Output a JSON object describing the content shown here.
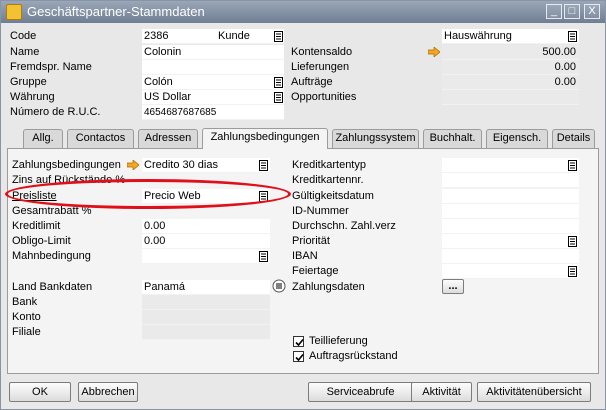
{
  "window": {
    "title": "Geschäftspartner-Stammdaten",
    "minimize": "_",
    "restore": "□",
    "close": "X"
  },
  "header": {
    "code_label": "Code",
    "code_value": "2386",
    "type_value": "Kunde",
    "name_label": "Name",
    "name_value": "Colonin",
    "foreign_label": "Fremdspr. Name",
    "foreign_value": "",
    "group_label": "Gruppe",
    "group_value": "Colón",
    "currency_label": "Währung",
    "currency_value": "US Dollar",
    "ruc_label": "Número de R.U.C.",
    "ruc_value": "4654687687685",
    "currency_mode_value": "Hauswährung",
    "balance_label": "Kontensaldo",
    "balance_value": "500.00",
    "deliveries_label": "Lieferungen",
    "deliveries_value": "0.00",
    "orders_label": "Aufträge",
    "orders_value": "0.00",
    "opportunities_label": "Opportunities",
    "opportunities_value": ""
  },
  "tabs": [
    "Allg.",
    "Contactos",
    "Adressen",
    "Zahlungsbedingungen",
    "Zahlungssystem",
    "Buchhalt.",
    "Eigensch.",
    "Details"
  ],
  "payment": {
    "terms_label": "Zahlungsbedingungen",
    "terms_value": "Credito 30 dias",
    "interest_label": "Zins auf Rückstände %",
    "pricelist_label": "Preisliste",
    "pricelist_value": "Precio Web",
    "discount_label": "Gesamtrabatt %",
    "creditlimit_label": "Kreditlimit",
    "creditlimit_value": "0.00",
    "commitment_label": "Obligo-Limit",
    "commitment_value": "0.00",
    "dunning_label": "Mahnbedingung",
    "dunning_value": "",
    "bankcountry_label": "Land Bankdaten",
    "bankcountry_value": "Panamá",
    "bank_label": "Bank",
    "account_label": "Konto",
    "branch_label": "Filiale",
    "cardtype_label": "Kreditkartentyp",
    "cardno_label": "Kreditkartennr.",
    "validity_label": "Gültigkeitsdatum",
    "id_label": "ID-Nummer",
    "avgdelay_label": "Durchschn. Zahl.verz",
    "priority_label": "Priorität",
    "iban_label": "IBAN",
    "holidays_label": "Feiertage",
    "paymentdata_label": "Zahlungsdaten",
    "paymentdata_button": "...",
    "partial_label": "Teillieferung",
    "backorder_label": "Auftragsrückstand"
  },
  "buttons": {
    "ok": "OK",
    "cancel": "Abbrechen",
    "service": "Serviceabrufe",
    "activity": "Aktivität",
    "activity_overview": "Aktivitätenübersicht"
  },
  "colors": {
    "title_bar": "#7c8aa0",
    "highlight_ring": "#e0101a",
    "arrow": "#f5a623"
  }
}
